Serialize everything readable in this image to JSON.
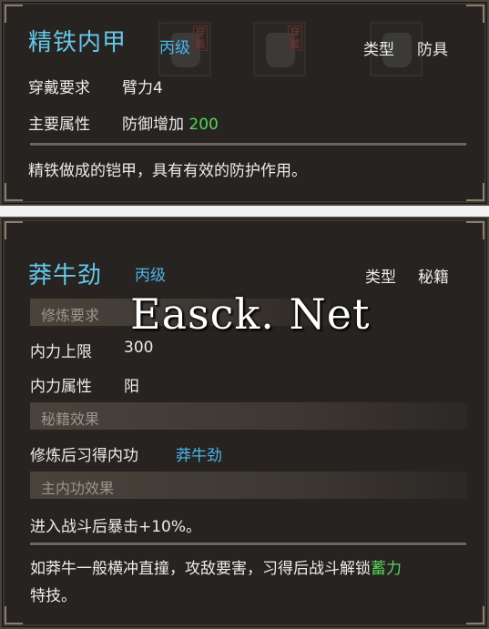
{
  "panel1": {
    "title": "精铁内甲",
    "grade": "丙级",
    "type_label": "类型",
    "type_value": "防具",
    "req_label": "穿戴要求",
    "req_value": "臂力4",
    "attr_label": "主要属性",
    "attr_value_text": "防御增加",
    "attr_value_num": "200",
    "description": "精铁做成的铠甲，具有有效的防护作用。",
    "ghost_tag": "穿戴"
  },
  "panel2": {
    "title": "莽牛劲",
    "grade": "丙级",
    "type_label": "类型",
    "type_value": "秘籍",
    "section_req": "修炼要求",
    "neili_limit_label": "内力上限",
    "neili_limit_value": "300",
    "neili_attr_label": "内力属性",
    "neili_attr_value": "阳",
    "section_effect": "秘籍效果",
    "learn_label": "修炼后习得内功",
    "learn_value": "莽牛劲",
    "section_main": "主内功效果",
    "main_effect": "进入战斗后暴击+10%。",
    "desc_line1_prefix": "如莽牛一般横冲直撞，攻敌要害，习得后战斗解锁",
    "desc_line1_highlight": "蓄力",
    "desc_line2": "特技。"
  },
  "watermark": "Easck. Net",
  "colors": {
    "title": "#67c7ea",
    "grade": "#4db3e6",
    "green": "#55d65a",
    "panel_bg": "#262320"
  }
}
